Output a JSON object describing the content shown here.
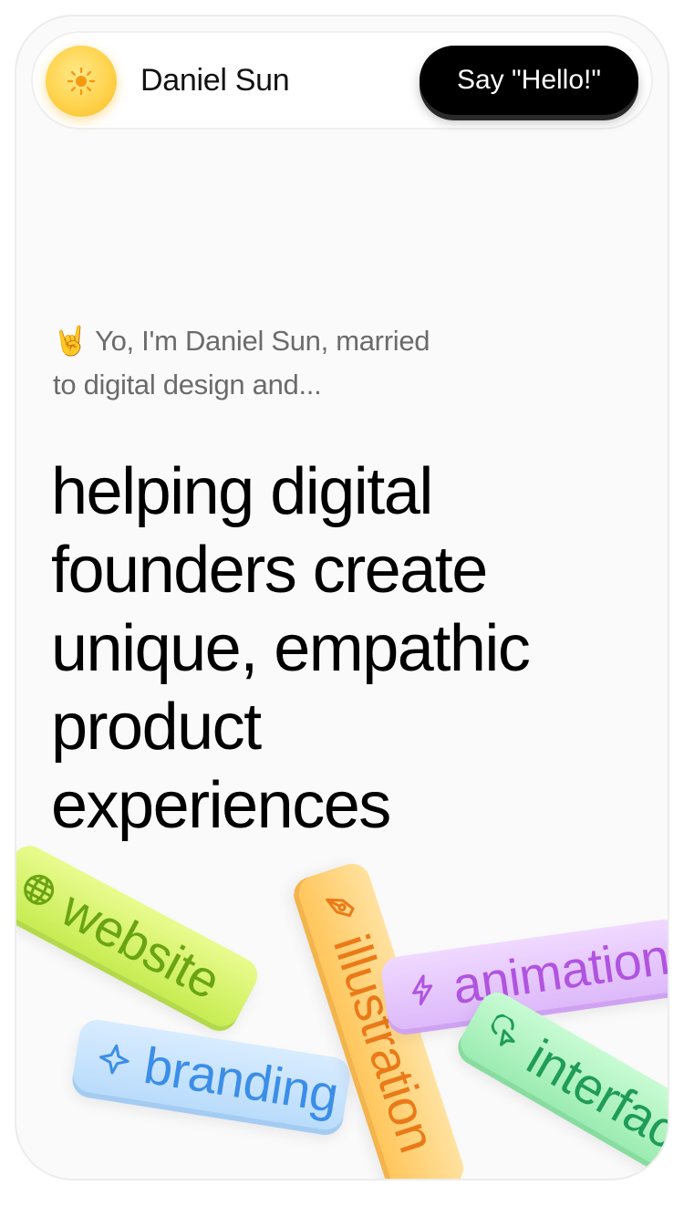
{
  "header": {
    "name": "Daniel Sun",
    "hello_button": "Say \"Hello!\"",
    "avatar_icon": "sun-icon"
  },
  "intro": {
    "emoji": "🤘",
    "line1": "Yo, I'm Daniel Sun, married",
    "line2": "to digital design and..."
  },
  "headline": {
    "lines": [
      "helping digital",
      "founders create",
      "unique, empathic",
      "product",
      "experiences"
    ]
  },
  "tags": [
    {
      "label": "website",
      "icon": "globe-icon",
      "color": "#6aa412"
    },
    {
      "label": "branding",
      "icon": "sparkle-icon",
      "color": "#3b8ee8"
    },
    {
      "label": "illustration",
      "icon": "pen-nib-icon",
      "color": "#ea7a18"
    },
    {
      "label": "animation",
      "icon": "lightning-icon",
      "color": "#b054e0"
    },
    {
      "label": "interface",
      "icon": "cursor-click-icon",
      "color": "#1f9c58"
    }
  ],
  "colors": {
    "accent_sun": "#ffd34d",
    "button_bg": "#000000"
  }
}
